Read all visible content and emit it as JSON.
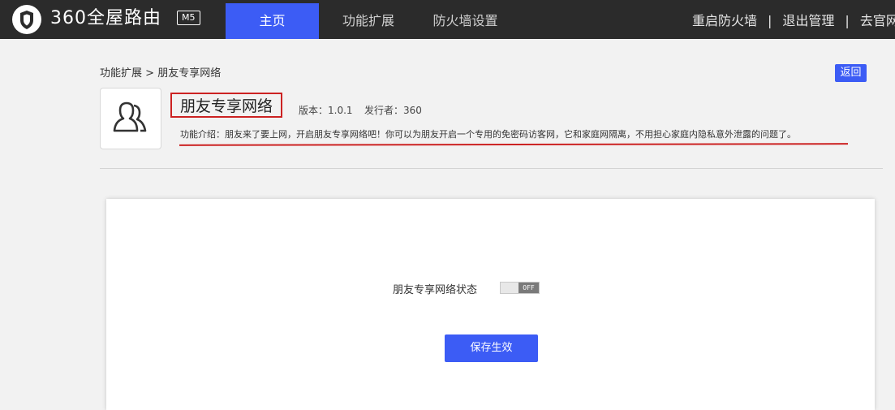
{
  "header": {
    "brand": "360全屋路由",
    "model": "M5",
    "tabs": [
      {
        "label": "主页",
        "active": true
      },
      {
        "label": "功能扩展",
        "active": false
      },
      {
        "label": "防火墙设置",
        "active": false
      }
    ],
    "right_links": [
      "重启防火墙",
      "退出管理",
      "去官网"
    ],
    "separator": "|"
  },
  "breadcrumb": {
    "parent": "功能扩展",
    "separator": ">",
    "current": "朋友专享网络"
  },
  "back_label": "返回",
  "app": {
    "icon": "user-group-icon",
    "title": "朋友专享网络",
    "version": "版本：1.0.1",
    "publisher": "发行者：360",
    "description": "功能介绍：朋友来了要上网，开启朋友专享网络吧！你可以为朋友开启一个专用的免密码访客网，它和家庭网隔离，不用担心家庭内隐私意外泄露的问题了。"
  },
  "form": {
    "status_label": "朋友专享网络状态",
    "toggle_state": "OFF",
    "save_label": "保存生效"
  },
  "colors": {
    "accent": "#3c5cf5",
    "topbar": "#2b2b2b",
    "highlight": "#cc2222"
  }
}
